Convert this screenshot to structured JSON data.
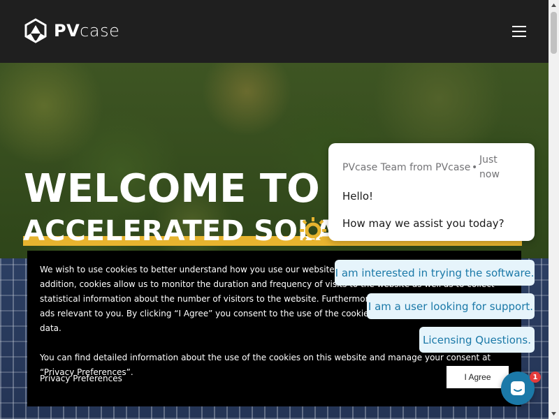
{
  "header": {
    "logo_text_bold": "PV",
    "logo_text_light": "case",
    "menu_icon": "hamburger-menu-icon"
  },
  "hero": {
    "title": "WELCOME TO THE",
    "subtitle": "ACCELERATED SOLAR",
    "accent_color": "#e7b42f"
  },
  "cookie_banner": {
    "paragraph1": "We wish to use cookies to better understand how you use our website. This allows us to improve our site. In addition, cookies allow us to monitor the duration and frequency of visits to the website as well as to collect statistical information about the number of visitors to the website. Furthermore, cookies allow us to show you ads relevant to you. By clicking “I Agree” you consent to the use of the cookies and the processing of your data.",
    "paragraph2": "You can find detailed information about the use of the cookies on this website and manage your consent at “Privacy Preferences”.",
    "privacy_link": "Privacy Preferences",
    "agree_button": "I Agree"
  },
  "chat": {
    "from": "PVcase Team from PVcase",
    "separator": "•",
    "time": "Just now",
    "line1": "Hello!",
    "line2": "How may we assist you today?",
    "replies": [
      "I am interested in trying the software.",
      "I am a user looking for support.",
      "Licensing Questions."
    ],
    "unread_count": "1",
    "brand_color": "#1b79a8"
  }
}
